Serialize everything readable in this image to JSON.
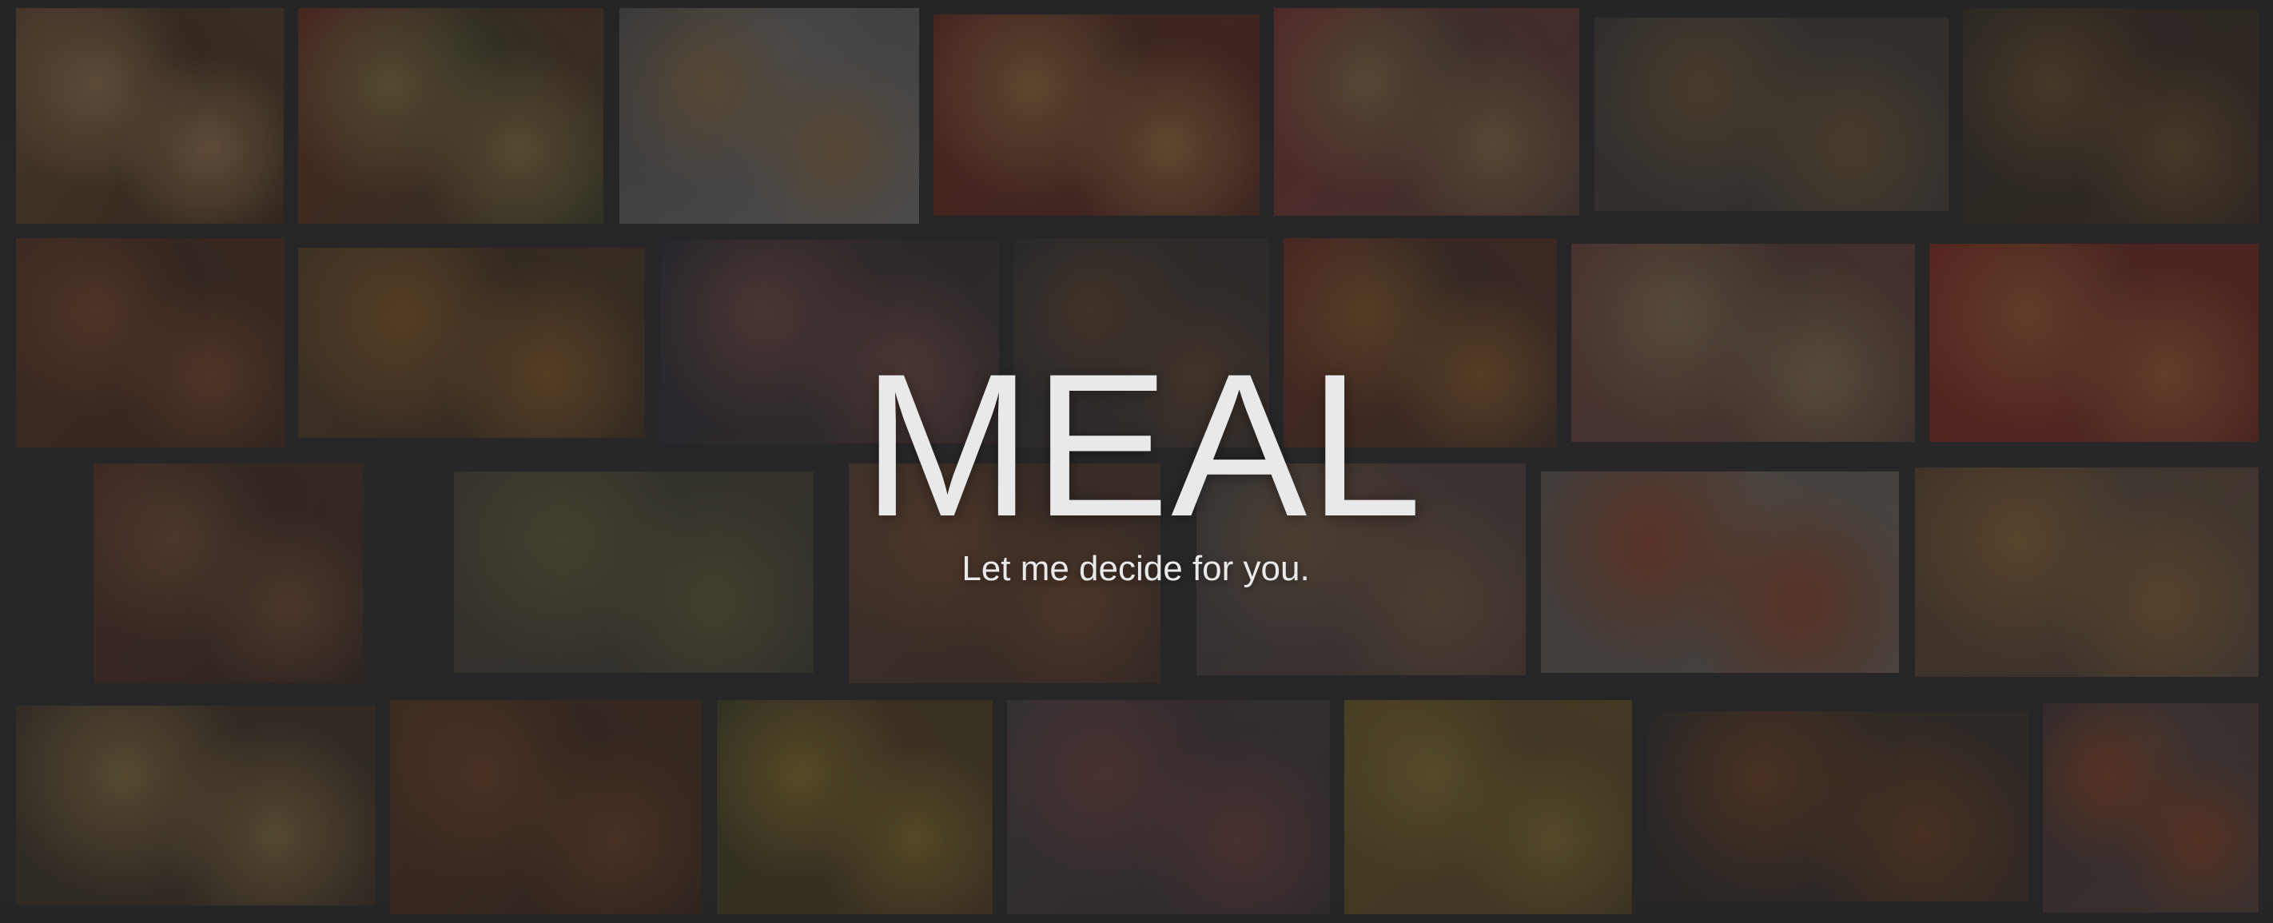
{
  "hero": {
    "title": "MEAL",
    "subtitle": "Let me decide for you."
  },
  "background_photos": [
    {
      "name": "tile-fried-chicken-basket",
      "colors": [
        "#5a4630",
        "#7a6045",
        "#3b2e22"
      ]
    },
    {
      "name": "tile-vegetable-spread",
      "colors": [
        "#5c2d24",
        "#6b5e3a",
        "#3a3b2a"
      ]
    },
    {
      "name": "tile-burger-and-fries-plate",
      "colors": [
        "#4a4a4c",
        "#6e5a3f",
        "#5e5e60"
      ]
    },
    {
      "name": "tile-sub-sandwich",
      "colors": [
        "#5a2c25",
        "#7a5a38",
        "#4b2c24"
      ]
    },
    {
      "name": "tile-milkshake-burger-fries",
      "colors": [
        "#6a3030",
        "#6d5a40",
        "#4a3a34"
      ]
    },
    {
      "name": "tile-asian-dishes-table",
      "colors": [
        "#3b3836",
        "#5b4a34",
        "#3f3a35"
      ]
    },
    {
      "name": "tile-noodle-bowls",
      "colors": [
        "#35302a",
        "#58462e",
        "#3a2e26"
      ]
    },
    {
      "name": "tile-pizza-slices",
      "colors": [
        "#4b3226",
        "#603d2b",
        "#3b2a22"
      ]
    },
    {
      "name": "tile-giant-burger",
      "colors": [
        "#4a3a2a",
        "#6a4a28",
        "#3a2f25"
      ]
    },
    {
      "name": "tile-donuts-and-burgers",
      "colors": [
        "#2a2c34",
        "#5a3f3a",
        "#3a3030"
      ]
    },
    {
      "name": "tile-grill-platter",
      "colors": [
        "#2f2f32",
        "#4d3c2e",
        "#3a332e"
      ]
    },
    {
      "name": "tile-citrus-fruits",
      "colors": [
        "#5a2e24",
        "#6a4a2a",
        "#3a2e28"
      ]
    },
    {
      "name": "tile-charcuterie-board",
      "colors": [
        "#5a3a36",
        "#6a5a46",
        "#4a3a32"
      ]
    },
    {
      "name": "tile-chili-peppers",
      "colors": [
        "#6a2a22",
        "#7a4a30",
        "#5a2a24"
      ]
    },
    {
      "name": "tile-chizza-box",
      "colors": [
        "#4a3028",
        "#5a4030",
        "#352a24"
      ]
    },
    {
      "name": "tile-ingredient-bowls",
      "colors": [
        "#3e3a32",
        "#4f4a34",
        "#3a3a30"
      ]
    },
    {
      "name": "tile-grilled-meat-board",
      "colors": [
        "#4a3a30",
        "#5a3d2e",
        "#3d2f28"
      ]
    },
    {
      "name": "tile-donut-stacks",
      "colors": [
        "#3a3a3c",
        "#5a4a3a",
        "#4a3a34"
      ]
    },
    {
      "name": "tile-pepperoni-pizza",
      "colors": [
        "#4b4a48",
        "#6a3a2a",
        "#5a5048"
      ]
    },
    {
      "name": "tile-burger-fries-ketchup",
      "colors": [
        "#4a3a2c",
        "#6a5032",
        "#4a4038"
      ]
    },
    {
      "name": "tile-mac-and-cheese-bread",
      "colors": [
        "#3a332a",
        "#6a5a38",
        "#3a3028"
      ]
    },
    {
      "name": "tile-pizza-burgers-overhead",
      "colors": [
        "#4a3326",
        "#5a3a28",
        "#3a2a22"
      ]
    },
    {
      "name": "tile-cheese-and-fruit",
      "colors": [
        "#3a3a26",
        "#6a5a2a",
        "#4a3a26"
      ]
    },
    {
      "name": "tile-donuts-overhead",
      "colors": [
        "#3d3a3c",
        "#5a3a36",
        "#3a3236"
      ]
    },
    {
      "name": "tile-popcorn",
      "colors": [
        "#5a4c2a",
        "#6a5a30",
        "#4a4026"
      ]
    },
    {
      "name": "tile-fruit-platter",
      "colors": [
        "#2c2c2c",
        "#5a3a26",
        "#3a3028"
      ]
    },
    {
      "name": "tile-character-plate",
      "colors": [
        "#3c3232",
        "#6a3a26",
        "#4a3c38"
      ]
    }
  ]
}
